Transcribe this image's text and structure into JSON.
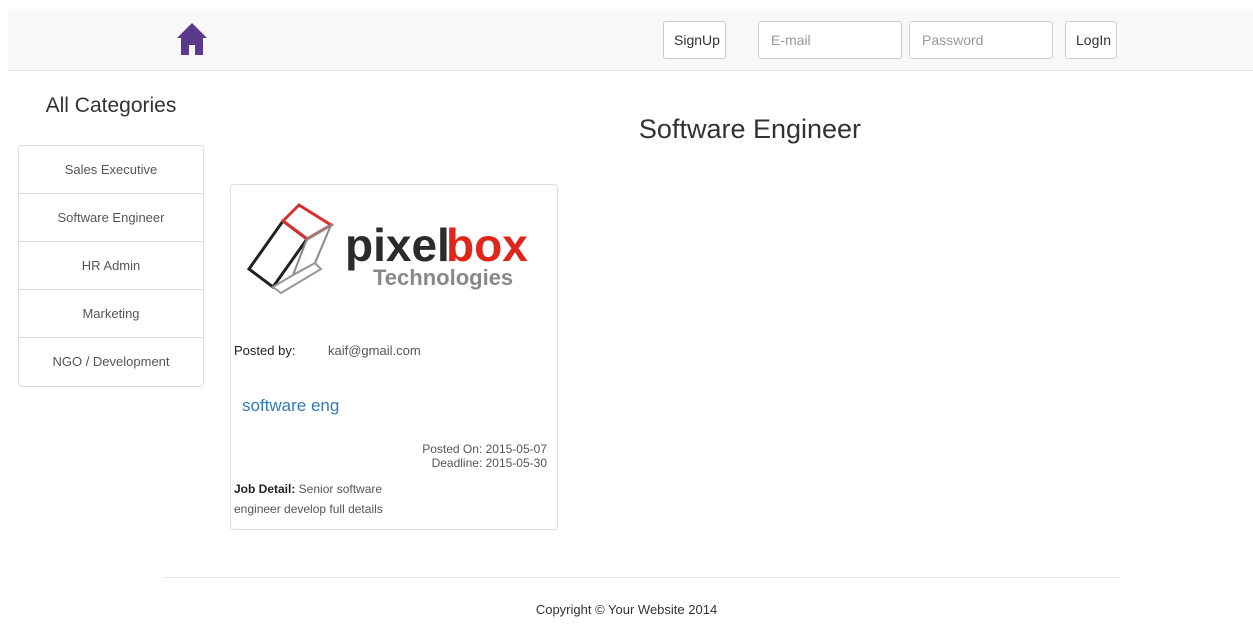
{
  "header": {
    "home_icon": "home-icon",
    "signup_label": "SignUp",
    "email_placeholder": "E-mail",
    "password_placeholder": "Password",
    "login_label": "LogIn",
    "accent_color": "#5b3a8c"
  },
  "sidebar": {
    "heading": "All Categories",
    "items": [
      {
        "label": "Sales Executive"
      },
      {
        "label": "Software Engineer"
      },
      {
        "label": "HR Admin"
      },
      {
        "label": "Marketing"
      },
      {
        "label": "NGO / Development"
      }
    ]
  },
  "main": {
    "title": "Software Engineer",
    "jobs": [
      {
        "logo_word1": "pixel",
        "logo_word2": "box",
        "logo_sub": "Technologies",
        "posted_by_label": "Posted by:",
        "posted_by_value": "kaif@gmail.com",
        "title": "software eng",
        "posted_on": "Posted On: 2015-05-07",
        "deadline": "Deadline: 2015-05-30",
        "detail_label": "Job Detail:",
        "detail_text": " Senior software engineer develop full details"
      }
    ]
  },
  "footer": {
    "copyright": "Copyright © Your Website 2014"
  }
}
